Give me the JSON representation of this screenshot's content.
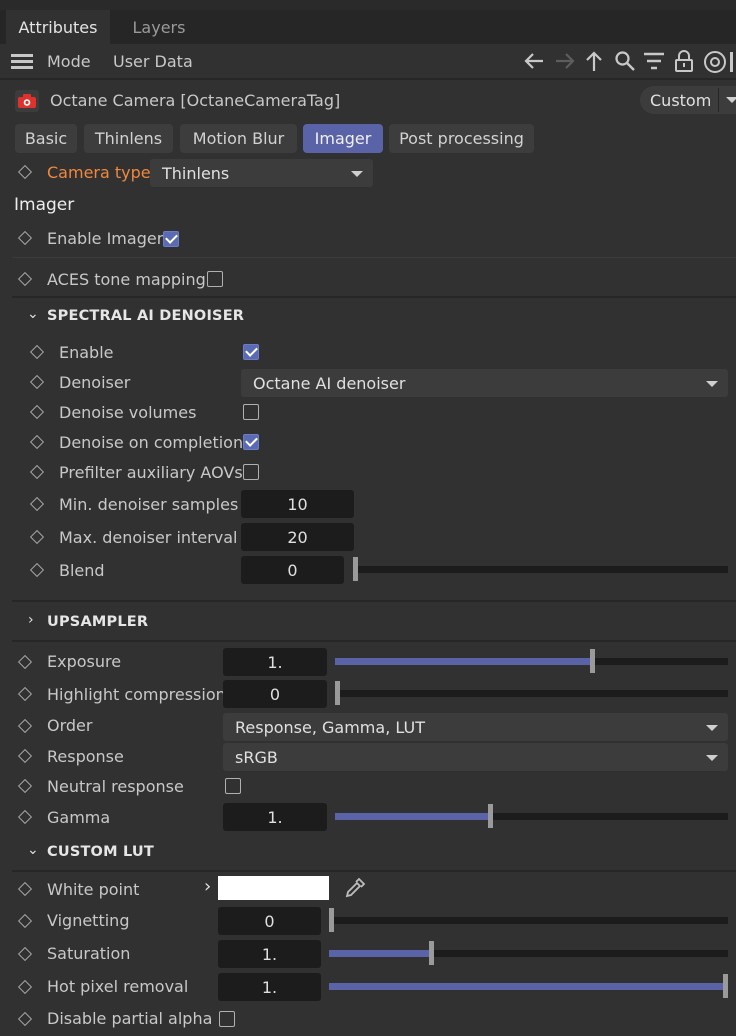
{
  "tabs": {
    "active": "Attributes",
    "other": "Layers"
  },
  "menu": {
    "mode": "Mode",
    "user_data": "User Data"
  },
  "object": {
    "title": "Octane Camera [OctaneCameraTag]",
    "preset": "Custom"
  },
  "subtabs": [
    "Basic",
    "Thinlens",
    "Motion Blur",
    "Imager",
    "Post processing"
  ],
  "subtab_selected": "Imager",
  "camera_type": {
    "label": "Camera type",
    "value": "Thinlens"
  },
  "section_title": "Imager",
  "enable_imager": {
    "label": "Enable Imager",
    "checked": true
  },
  "aces": {
    "label": "ACES tone mapping",
    "checked": false
  },
  "denoiser_section": {
    "title": "SPECTRAL AI DENOISER",
    "enable": {
      "label": "Enable",
      "checked": true
    },
    "denoiser": {
      "label": "Denoiser",
      "value": "Octane AI denoiser"
    },
    "denoise_volumes": {
      "label": "Denoise volumes",
      "checked": false
    },
    "denoise_on_completion": {
      "label": "Denoise on completion",
      "checked": true
    },
    "prefilter": {
      "label": "Prefilter auxiliary AOVs",
      "checked": false
    },
    "min_samples": {
      "label": "Min. denoiser samples",
      "value": "10"
    },
    "max_interval": {
      "label": "Max. denoiser interval",
      "value": "20"
    },
    "blend": {
      "label": "Blend",
      "value": "0",
      "level": 0
    }
  },
  "upsampler": {
    "title": "UPSAMPLER"
  },
  "exposure": {
    "label": "Exposure",
    "value": "1.",
    "level": 0.65
  },
  "highlight": {
    "label": "Highlight compression",
    "value": "0",
    "level": 0
  },
  "order": {
    "label": "Order",
    "value": "Response, Gamma, LUT"
  },
  "response": {
    "label": "Response",
    "value": "sRGB"
  },
  "neutral_response": {
    "label": "Neutral response",
    "checked": false
  },
  "gamma": {
    "label": "Gamma",
    "value": "1.",
    "level": 0.39
  },
  "custom_lut": {
    "title": "CUSTOM LUT"
  },
  "white_point": {
    "label": "White point",
    "color": "#ffffff"
  },
  "vignetting": {
    "label": "Vignetting",
    "value": "0",
    "level": 0
  },
  "saturation": {
    "label": "Saturation",
    "value": "1.",
    "level": 0.25
  },
  "hot_pixel": {
    "label": "Hot pixel removal",
    "value": "1.",
    "level": 1
  },
  "disable_alpha": {
    "label": "Disable partial alpha",
    "checked": false
  },
  "colors": {
    "accent": "#5a63a8",
    "highlight_label": "#f0883e",
    "background": "#313131"
  }
}
